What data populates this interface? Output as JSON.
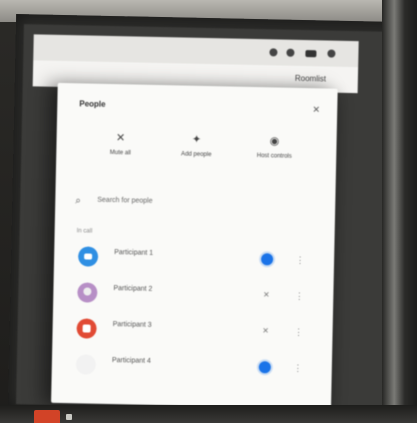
{
  "window": {
    "toolbar_text": "Roomlist"
  },
  "panel": {
    "title": "People",
    "close_icon": "×"
  },
  "actions": [
    {
      "label": "Mute all",
      "icon": "mic-off-icon"
    },
    {
      "label": "Add people",
      "icon": "person-add-icon"
    },
    {
      "label": "Host controls",
      "icon": "toggle-icon"
    }
  ],
  "search": {
    "placeholder": "Search for people"
  },
  "section": {
    "label": "In call"
  },
  "participants": [
    {
      "name": "Participant 1",
      "meta": "",
      "avatar_color": "#2f8fe3",
      "mic_active": true
    },
    {
      "name": "Participant 2",
      "meta": "",
      "avatar_color": "#b78fc6",
      "mic_active": false
    },
    {
      "name": "Participant 3",
      "meta": "",
      "avatar_color": "#e14a34",
      "mic_active": false
    },
    {
      "name": "Participant 4",
      "meta": "",
      "avatar_color": "#f2f2f2",
      "mic_active": true
    }
  ]
}
